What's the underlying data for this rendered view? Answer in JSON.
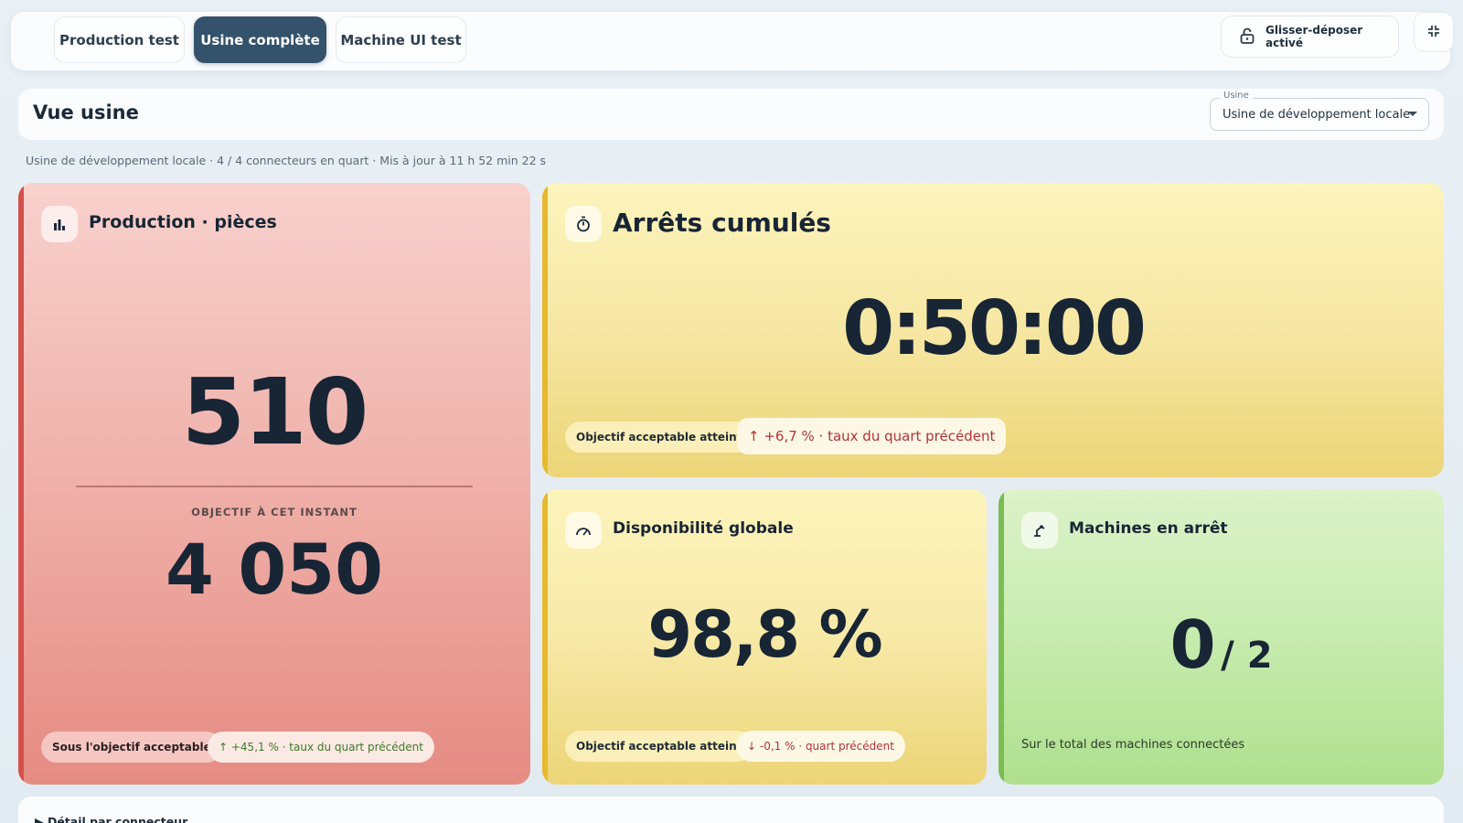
{
  "tabs": [
    {
      "label": "Production test",
      "active": false
    },
    {
      "label": "Usine complète",
      "active": true
    },
    {
      "label": "Machine UI test",
      "active": false
    }
  ],
  "toolbar": {
    "dnd_label": "Glisser-déposer activé",
    "lock_icon": "lock-open-icon",
    "collapse_icon": "collapse-icon"
  },
  "header": {
    "title": "Vue usine",
    "select_legend": "Usine",
    "select_value": "Usine de développement locale"
  },
  "subline": "Usine de développement locale · 4 / 4 connecteurs en quart · Mis à jour à 11 h 52 min 22 s",
  "cards": {
    "production": {
      "title": "Production · pièces",
      "icon": "bar-chart-icon",
      "value": "510",
      "target_label": "OBJECTIF À CET INSTANT",
      "target_value": "4 050",
      "status_pill": "Sous l'objectif acceptable",
      "delta_pill": "↑ +45,1 % · taux du quart précédent",
      "accent": "#d4514b"
    },
    "arrets": {
      "title": "Arrêts cumulés",
      "icon": "stopwatch-icon",
      "value": "0:50:00",
      "status_pill": "Objectif acceptable atteint",
      "delta_pill": "↑ +6,7 % · taux du quart précédent",
      "accent": "#e6b92f"
    },
    "disponibilite": {
      "title": "Disponibilité globale",
      "icon": "gauge-icon",
      "value": "98,8 %",
      "status_pill": "Objectif acceptable atteint",
      "delta_pill": "↓ -0,1 % · quart précédent",
      "accent": "#e6b92f"
    },
    "machines": {
      "title": "Machines en arrêt",
      "icon": "robot-arm-icon",
      "value": "0",
      "total": "/ 2",
      "footer": "Sur le total des machines connectées",
      "accent": "#7bbd55"
    }
  },
  "detail": {
    "label": "▶ Détail par connecteur"
  },
  "colors": {
    "delta_up_green": "#3f7a2a",
    "delta_red": "#b3323a",
    "active_tab": "#34526b"
  }
}
